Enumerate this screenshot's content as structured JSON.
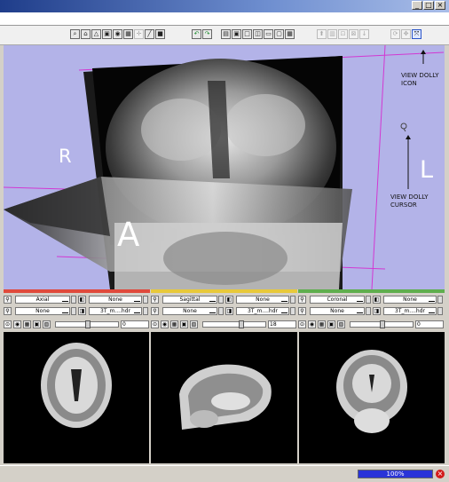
{
  "window": {
    "controls": [
      "_",
      "□",
      "×"
    ]
  },
  "toolbar": {
    "icons": [
      "zoom-icon",
      "home-icon",
      "layout-icon",
      "window-icon",
      "spin-icon",
      "cube-icon",
      "fiducial-icon",
      "ruler-icon",
      "contrast-icon",
      "undo-icon",
      "redo-icon",
      "layout-conventional-icon",
      "layout-fourup-icon",
      "layout-single-icon",
      "layout-split-icon",
      "layout-red-icon",
      "layout-grid-icon",
      "camera-icon",
      "light-icon",
      "tool-icon",
      "pin-icon",
      "arrow-down-icon",
      "rotate-icon",
      "pan-icon",
      "dolly-icon"
    ]
  },
  "viewport3d": {
    "orientation": {
      "right": "R",
      "left": "L",
      "anterior": "A"
    },
    "annotations": {
      "dolly_icon": "VIEW DOLLY\nICON",
      "dolly_cursor": "VIEW DOLLY\nCURSOR"
    },
    "background_color": "#b3b3e8"
  },
  "panels": [
    {
      "color": "#e04a3c",
      "orientation": "Axial",
      "fg": "None",
      "bg": "None",
      "label_layer": "3T_m....hdr",
      "slice_value": "0",
      "slider_fraction": 0.5
    },
    {
      "color": "#e8c93a",
      "orientation": "Sagittal",
      "fg": "None",
      "bg": "None",
      "label_layer": "3T_m....hdr",
      "slice_value": "18",
      "slider_fraction": 0.6
    },
    {
      "color": "#5fae4e",
      "orientation": "Coronal",
      "fg": "None",
      "bg": "None",
      "label_layer": "3T_m....hdr",
      "slice_value": "0",
      "slider_fraction": 0.5
    }
  ],
  "status": {
    "progress_text": "100%",
    "progress_fraction": 1.0,
    "error_icon": "error-icon"
  }
}
